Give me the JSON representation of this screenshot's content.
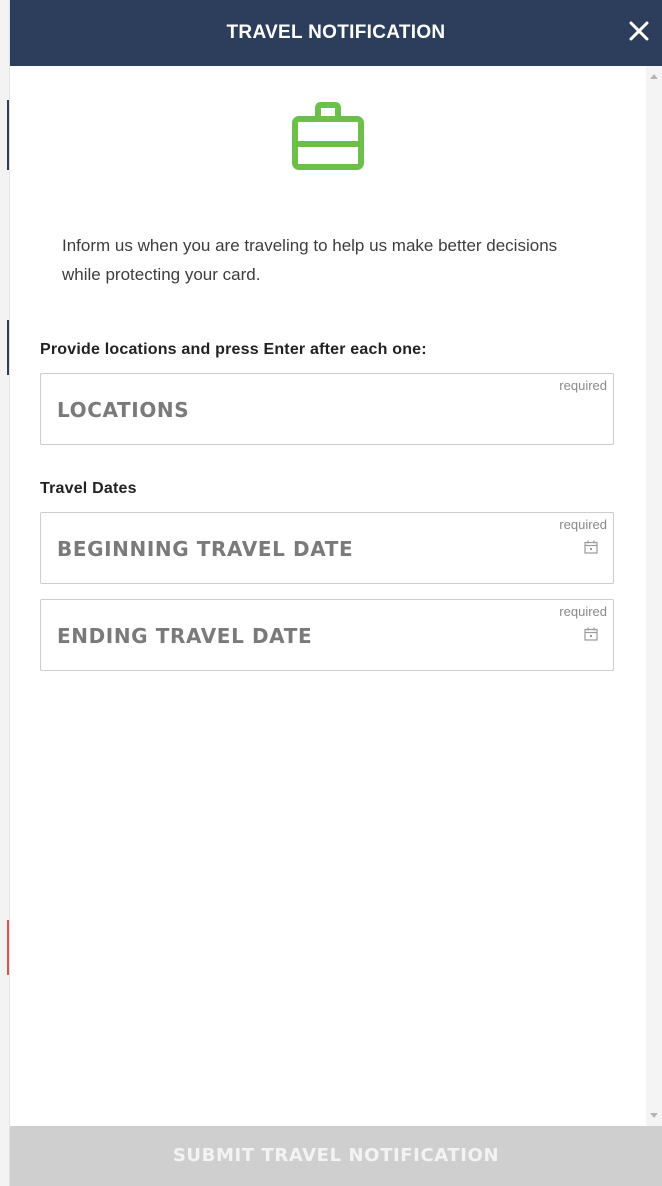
{
  "header": {
    "title": "TRAVEL NOTIFICATION"
  },
  "icons": {
    "main": "briefcase-icon",
    "close": "close-icon",
    "calendar": "calendar-icon"
  },
  "colors": {
    "header_bg": "#2c3e5c",
    "accent_green": "#6cc04a",
    "submit_disabled_bg": "#cfcfcf"
  },
  "intro": {
    "text": "Inform us when you are traveling to help us make better decisions while protecting your card."
  },
  "locations": {
    "label": "Provide locations and press Enter after each one:",
    "placeholder": "LOCATIONS",
    "required": "required"
  },
  "dates": {
    "label": "Travel Dates",
    "begin": {
      "placeholder": "BEGINNING TRAVEL DATE",
      "required": "required"
    },
    "end": {
      "placeholder": "ENDING TRAVEL DATE",
      "required": "required"
    }
  },
  "submit": {
    "label": "SUBMIT TRAVEL NOTIFICATION"
  }
}
